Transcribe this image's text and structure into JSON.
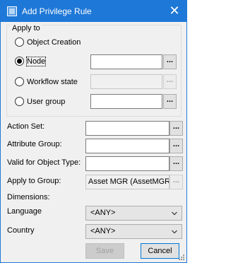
{
  "window": {
    "title": "Add Privilege Rule",
    "close_glyph": "✕"
  },
  "apply_to": {
    "legend": "Apply to",
    "options": [
      {
        "label": "Object Creation",
        "checked": false
      },
      {
        "label": "Node",
        "checked": true
      },
      {
        "label": "Workflow state",
        "checked": false
      },
      {
        "label": "User group",
        "checked": false
      }
    ]
  },
  "fields": {
    "action_set": {
      "label": "Action Set:",
      "value": ""
    },
    "attribute_group": {
      "label": "Attribute Group:",
      "value": ""
    },
    "valid_for_object_type": {
      "label": "Valid for Object Type:",
      "value": ""
    },
    "apply_to_group": {
      "label": "Apply to Group:",
      "value": "Asset MGR (AssetMGR)"
    }
  },
  "dimensions": {
    "label": "Dimensions:",
    "language": {
      "label": "Language",
      "value": "<ANY>"
    },
    "country": {
      "label": "Country",
      "value": "<ANY>"
    }
  },
  "buttons": {
    "ellipsis": "...",
    "save": "Save",
    "cancel": "Cancel"
  },
  "colors": {
    "titlebar": "#1e78d7",
    "window_bg": "#f0f0f0"
  }
}
